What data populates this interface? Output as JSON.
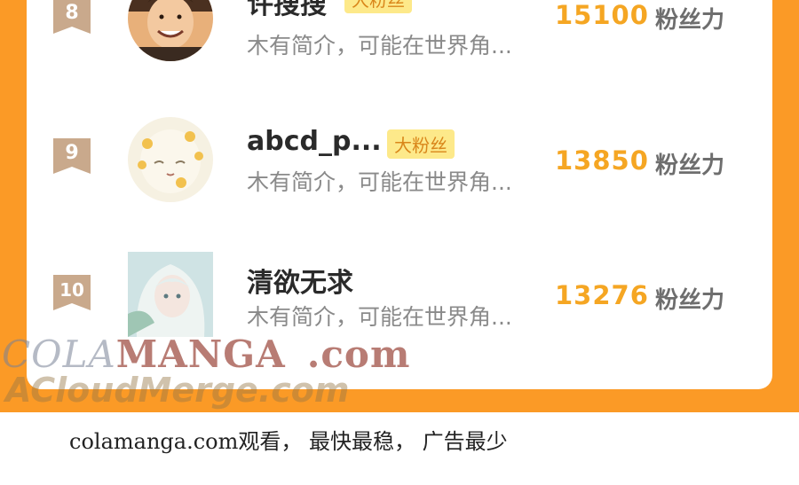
{
  "colors": {
    "accent_orange": "#fb9a26",
    "score_gold": "#f5a623",
    "badge_bg": "#fde98a",
    "rank_tag": "#c9a98c"
  },
  "rows": [
    {
      "rank": "8",
      "name": "许搜搜",
      "badge": "大粉丝",
      "bio": "木有简介，可能在世界角...",
      "score": "15100",
      "unit": "粉丝力",
      "avatar": "avatar-man-smiling"
    },
    {
      "rank": "9",
      "name": "abcd_p...",
      "badge": "大粉丝",
      "bio": "木有简介，可能在世界角...",
      "score": "13850",
      "unit": "粉丝力",
      "avatar": "avatar-anime-flowers"
    },
    {
      "rank": "10",
      "name": "清欲无求",
      "badge": "",
      "bio": "木有简介，可能在世界角...",
      "score": "13276",
      "unit": "粉丝力",
      "avatar": "avatar-anime-girl"
    }
  ],
  "watermark": {
    "part1": "COLA",
    "part2": "MANGA",
    "part3": ".com",
    "line2": "ACloudMerge.com"
  },
  "footer_text": "colamanga.com观看， 最快最稳， 广告最少"
}
